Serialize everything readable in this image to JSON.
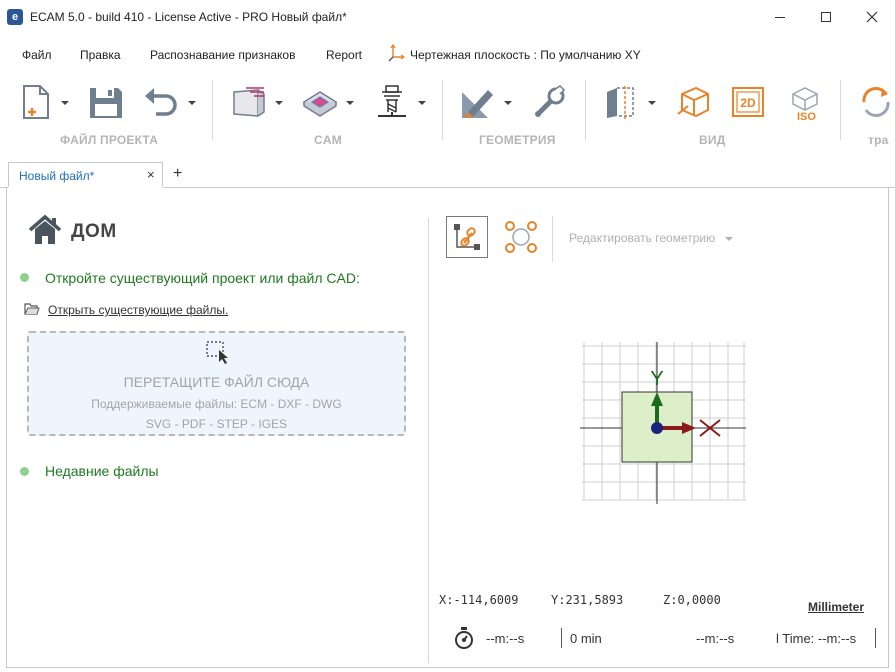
{
  "window": {
    "title": "ECAM 5.0 - build 410 - License Active - PRO Новый файл*",
    "app_icon_letter": "e",
    "minimize_icon": "minimize-icon",
    "maximize_icon": "maximize-icon",
    "close_icon": "close-icon"
  },
  "menu": {
    "items": [
      "Файл",
      "Правка",
      "Распознавание признаков",
      "Report"
    ],
    "plane_label": "Чертежная плоскость : По умолчанию XY"
  },
  "ribbon": {
    "groups": [
      {
        "label": "ФАЙЛ ПРОЕКТА",
        "icons": [
          "new-file-icon",
          "save-icon",
          "undo-icon"
        ]
      },
      {
        "label": "CAM",
        "icons": [
          "stock-icon",
          "pocket-icon",
          "tool-icon"
        ]
      },
      {
        "label": "ГЕОМЕТРИЯ",
        "icons": [
          "pencil-ruler-icon",
          "wrench-icon"
        ]
      },
      {
        "label": "ВИД",
        "icons": [
          "section-view-icon",
          "3d-view-icon",
          "2d-view-icon",
          "iso-view-icon"
        ]
      },
      {
        "label": "тра",
        "icons": [
          "transform-icon"
        ]
      }
    ],
    "view_2d_text": "2D",
    "view_iso_text": "ISO",
    "colors": {
      "accent_orange": "#e8832a",
      "icon_gray": "#6f7f8f",
      "label_gray": "#b5b5b5"
    }
  },
  "tabs": {
    "document_tab": "Новый файл*",
    "close": "×",
    "add": "+"
  },
  "home": {
    "title": "ДОМ",
    "open_section": "Откройте существующий проект или файл CAD:",
    "open_link": "Открыть существующие файлы.",
    "dropzone": {
      "title": "ПЕРЕТАЩИТЕ ФАЙЛ СЮДА",
      "line1": "Поддерживаемые файлы:    ECM - DXF - DWG",
      "line2": "SVG - PDF - STEP - IGES"
    },
    "recent_section": "Недавние файлы",
    "colors": {
      "section_green": "#1f7a1f",
      "dot_green": "#8ed18e",
      "drop_bg": "#eef5fc"
    }
  },
  "viewer": {
    "edit_geometry": "Редактировать геометрию",
    "axis_y_label": "Y",
    "coords": {
      "x": "X:-114,6009",
      "y": "Y:231,5893",
      "z": "Z:0,0000"
    },
    "units": "Millimeter",
    "colors": {
      "axis_y": "#1a6b1a",
      "axis_x": "#8b1a1a",
      "origin": "#1a237e",
      "stock_fill": "#dcefc9"
    }
  },
  "status": {
    "timer1": "--m:--s",
    "minutes": "0 min",
    "timer2": "--m:--s",
    "time_label": "l Time: --m:--s"
  }
}
